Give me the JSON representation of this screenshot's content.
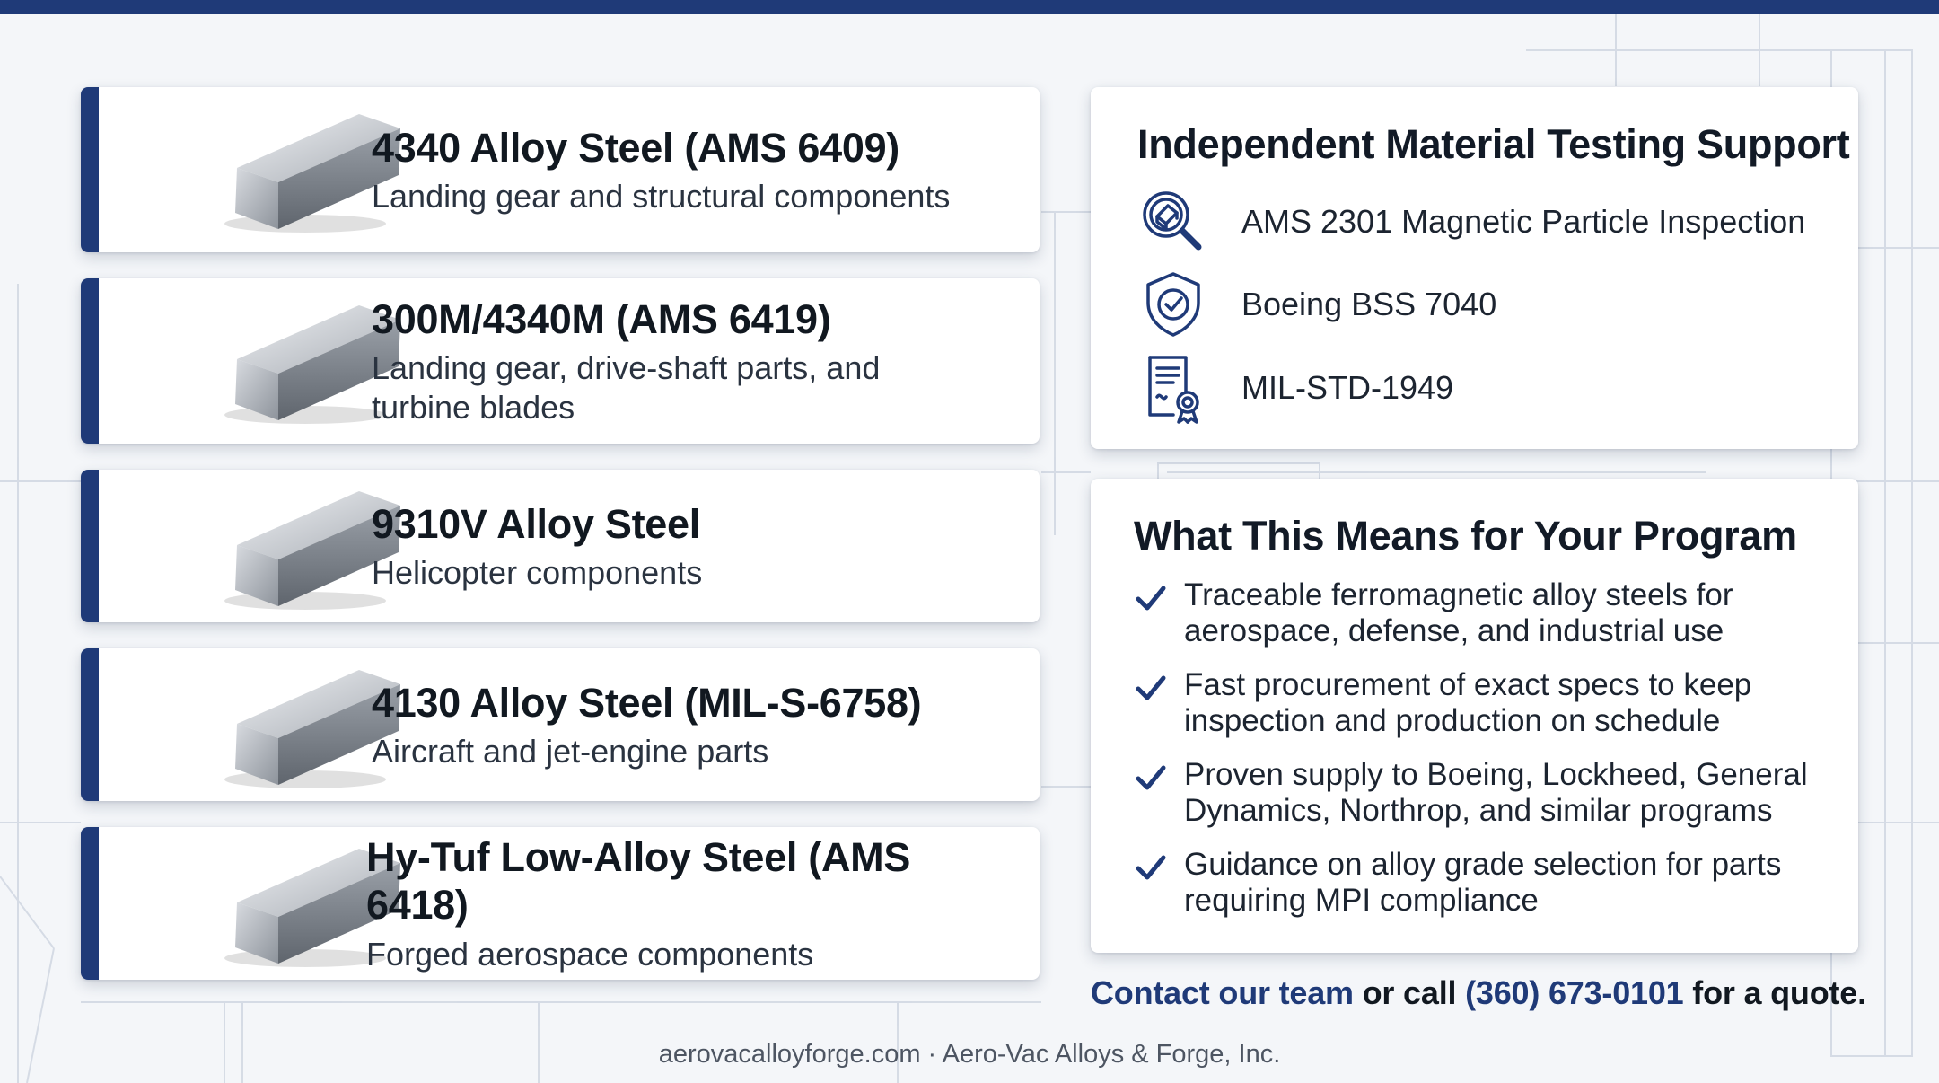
{
  "colors": {
    "navy": "#1f3a78",
    "background": "#f4f6f9",
    "card": "#ffffff"
  },
  "materials": [
    {
      "name": "4340 Alloy Steel (AMS 6409)",
      "description": "Landing gear and structural components",
      "icon": "steel-bar-image"
    },
    {
      "name": "300M/4340M (AMS 6419)",
      "description": "Landing gear, drive-shaft parts, and turbine blades",
      "icon": "steel-bar-image"
    },
    {
      "name": "9310V Alloy Steel",
      "description": "Helicopter components",
      "icon": "steel-bar-image"
    },
    {
      "name": "4130 Alloy Steel (MIL-S-6758)",
      "description": "Aircraft and jet-engine parts",
      "icon": "steel-bar-image"
    },
    {
      "name": "Hy-Tuf Low-Alloy Steel (AMS 6418)",
      "description": "Forged aerospace components",
      "icon": "steel-bar-image"
    }
  ],
  "testing": {
    "title": "Independent Material Testing Support",
    "items": [
      {
        "label": "AMS 2301 Magnetic Particle Inspection",
        "icon": "magnifier-inspection-icon"
      },
      {
        "label": "Boeing BSS 7040",
        "icon": "shield-check-icon"
      },
      {
        "label": "MIL-STD-1949",
        "icon": "certificate-ribbon-icon"
      }
    ]
  },
  "benefits": {
    "title": "What This Means for Your Program",
    "items": [
      "Traceable ferromagnetic alloy steels for aerospace, defense, and industrial use",
      "Fast procurement of exact specs to keep inspection and production on schedule",
      "Proven supply to Boeing, Lockheed, General Dynamics, Northrop, and similar programs",
      "Guidance on alloy grade selection for parts requiring MPI compliance"
    ]
  },
  "cta": {
    "link_text": "Contact our team",
    "middle_text": " or call ",
    "phone": "(360) 673-0101",
    "end_text": " for a quote."
  },
  "footer": {
    "text": "aerovacalloyforge.com · Aero-Vac Alloys & Forge, Inc."
  }
}
